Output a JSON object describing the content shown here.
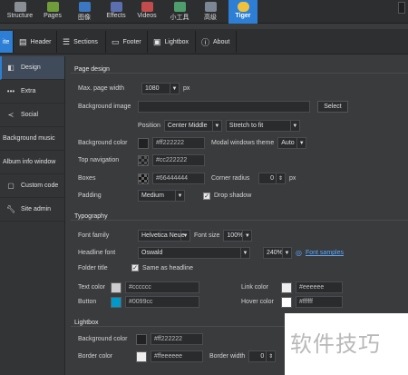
{
  "toolbar": {
    "items": [
      {
        "label": "Structure",
        "icon": "structure-icon",
        "color": "#8a8f96"
      },
      {
        "label": "Pages",
        "icon": "pages-icon",
        "color": "#6f9d3a"
      },
      {
        "label": "图像",
        "icon": "images-icon",
        "color": "#3a78c4"
      },
      {
        "label": "Effects",
        "icon": "effects-icon",
        "color": "#5b6fb0"
      },
      {
        "label": "Videos",
        "icon": "videos-icon",
        "color": "#c24b4b"
      },
      {
        "label": "小工具",
        "icon": "widgets-icon",
        "color": "#4e9e6d"
      },
      {
        "label": "高级",
        "icon": "advanced-icon",
        "color": "#7b8794"
      },
      {
        "label": "Tiger",
        "icon": "tiger-icon",
        "color": "#f0c23b"
      }
    ]
  },
  "tabs": [
    {
      "label": "ite",
      "icon": "site-icon"
    },
    {
      "label": "Header",
      "icon": "header-icon"
    },
    {
      "label": "Sections",
      "icon": "sections-icon"
    },
    {
      "label": "Footer",
      "icon": "footer-icon"
    },
    {
      "label": "Lightbox",
      "icon": "lightbox-icon"
    },
    {
      "label": "About",
      "icon": "info-icon"
    }
  ],
  "sidebar": {
    "items": [
      {
        "label": "Design",
        "icon": "design-icon"
      },
      {
        "label": "Extra",
        "icon": "extra-icon"
      },
      {
        "label": "Social",
        "icon": "share-icon"
      },
      {
        "label": "Background music",
        "icon": ""
      },
      {
        "label": "Album info window",
        "icon": ""
      },
      {
        "label": "Custom code",
        "icon": "code-icon"
      },
      {
        "label": "Site admin",
        "icon": "wrench-icon"
      }
    ]
  },
  "page_design": {
    "title": "Page design",
    "max_width_label": "Max. page width",
    "max_width_value": "1080",
    "max_width_unit": "px",
    "bg_image_label": "Background image",
    "bg_image_value": "",
    "select_button": "Select",
    "position_label": "Position",
    "position_value": "Center Middle",
    "fit_value": "Stretch to fit",
    "bg_color_label": "Background color",
    "bg_color_value": "#ff222222",
    "bg_color_swatch": "#222222",
    "modal_theme_label": "Modal windows theme",
    "modal_theme_value": "Auto",
    "top_nav_label": "Top navigation",
    "top_nav_value": "#cc222222",
    "top_nav_swatch": "#222222",
    "boxes_label": "Boxes",
    "boxes_value": "#66444444",
    "boxes_swatch": "#444444",
    "corner_radius_label": "Corner radius",
    "corner_radius_value": "0",
    "corner_radius_unit": "px",
    "padding_label": "Padding",
    "padding_value": "Medium",
    "drop_shadow_label": "Drop shadow"
  },
  "typography": {
    "title": "Typography",
    "font_family_label": "Font family",
    "font_family_value": "Helvetica Neue",
    "font_size_label": "Font size",
    "font_size_value": "100%",
    "headline_font_label": "Headline font",
    "headline_font_value": "Oswald",
    "headline_size_value": "240%",
    "font_samples_link": "Font samples",
    "folder_title_label": "Folder title",
    "same_as_headline_label": "Same as headline",
    "text_color_label": "Text color",
    "text_color_value": "#cccccc",
    "text_color_swatch": "#cccccc",
    "link_color_label": "Link color",
    "link_color_value": "#eeeeee",
    "link_color_swatch": "#eeeeee",
    "button_label": "Button",
    "button_value": "#0099cc",
    "button_swatch": "#0099cc",
    "hover_color_label": "Hover color",
    "hover_color_value": "#ffffff",
    "hover_color_swatch": "#ffffff"
  },
  "lightbox": {
    "title": "Lightbox",
    "bg_color_label": "Background color",
    "bg_color_value": "#ff222222",
    "bg_color_swatch": "#222222",
    "border_color_label": "Border color",
    "border_color_value": "#ffeeeeee",
    "border_color_swatch": "#eeeeee",
    "border_width_label": "Border width",
    "border_width_value": "0"
  },
  "watermark": {
    "text": "软件技巧"
  }
}
